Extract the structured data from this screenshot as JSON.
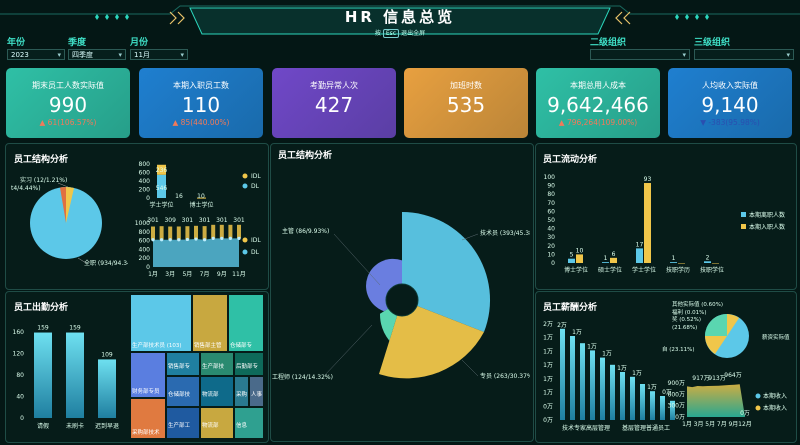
{
  "header": {
    "title": "HR 信息总览",
    "hint_pre": "按",
    "hint_key": "Esc",
    "hint_post": "退出全屏"
  },
  "filters": {
    "year": {
      "label": "年份",
      "value": "2023"
    },
    "quarter": {
      "label": "季度",
      "value": "四季度"
    },
    "month": {
      "label": "月份",
      "value": "11月"
    },
    "org2": {
      "label": "二级组织",
      "value": ""
    },
    "org3": {
      "label": "三级组织",
      "value": ""
    }
  },
  "kpis": [
    {
      "title": "期末员工人数实际值",
      "value": "990",
      "change": "▲ 61(106.57%)",
      "color": "#2fc0a6"
    },
    {
      "title": "本期入职员工数",
      "value": "110",
      "change": "▲ 85(440.00%)",
      "color": "#1f7fd0"
    },
    {
      "title": "考勤异常人次",
      "value": "427",
      "change": "",
      "color": "#7048c8"
    },
    {
      "title": "加班时数",
      "value": "535",
      "change": "",
      "color": "#e8a040"
    },
    {
      "title": "本期总用人成本",
      "value": "9,642,466",
      "change": "▲ 796,264(109.00%)",
      "color": "#2fc0a6"
    },
    {
      "title": "人均收入实际值",
      "value": "9,140",
      "change": "▼ -383(95.98%)",
      "color": "#1f7fd0"
    }
  ],
  "panels": {
    "structure_left": "员工结构分析",
    "structure_center": "员工结构分析",
    "flow": "员工流动分析",
    "attendance": "员工出勤分析",
    "salary": "员工薪酬分析"
  },
  "structure_pie": {
    "labels": [
      "实习 (12/1.21%)",
      "t4/4.44%)",
      "全职 (934/94.34%)"
    ]
  },
  "edu_bar": {
    "yticks": [
      "800",
      "600",
      "400",
      "200",
      "0"
    ],
    "categories": [
      "学士学位",
      "博士学位"
    ],
    "idl": [
      236,
      10
    ],
    "dl": [
      546,
      0
    ],
    "data_labels": [
      "236",
      "546",
      "16",
      "10"
    ],
    "legend": [
      "IDL",
      "DL"
    ]
  },
  "month_chart": {
    "yticks": [
      "1000",
      "800",
      "600",
      "400",
      "200",
      "0"
    ],
    "months": [
      "1月",
      "3月",
      "5月",
      "7月",
      "9月",
      "11月"
    ],
    "idl": [
      301,
      309,
      301,
      301,
      301,
      301,
      309,
      309,
      309,
      309,
      309
    ],
    "dl": [
      619,
      619,
      619,
      620,
      626,
      635,
      620,
      650,
      650,
      650,
      650
    ],
    "top_labels": [
      "301",
      "309",
      "301",
      "301",
      "301",
      "301"
    ],
    "legend": [
      "IDL",
      "DL"
    ]
  },
  "rose": {
    "labels": [
      "主管 (86/9.93%)",
      "技术员 (393/45.38%)",
      "专员 (263/30.37%)",
      "工程师 (124/14.32%)"
    ]
  },
  "flow_chart": {
    "yticks": [
      "100",
      "90",
      "80",
      "70",
      "60",
      "50",
      "40",
      "30",
      "20",
      "10",
      "0"
    ],
    "categories": [
      "博士学位",
      "硕士学位",
      "学士学位",
      "技职学历",
      "技职学位"
    ],
    "leave": [
      5,
      1,
      17,
      1,
      2
    ],
    "join": [
      10,
      6,
      93,
      0,
      0
    ],
    "legend": [
      "本期离职人数",
      "本期入职人数"
    ]
  },
  "attendance": {
    "yticks": [
      "160",
      "120",
      "80",
      "40",
      "0"
    ],
    "categories": [
      "请假",
      "未刷卡",
      "迟到早退"
    ],
    "values": [
      159,
      159,
      109
    ],
    "labels": [
      "159",
      "159",
      "109"
    ]
  },
  "treemap": [
    "生产部技术员 (103)",
    "销售部主管",
    "仓储部专",
    "财务部专员",
    "销售部专",
    "生产部技",
    "后勤部专",
    "采购部技术",
    "仓储部技",
    "物流部",
    "采购",
    "人事",
    "生产部工",
    "物流部",
    "信息"
  ],
  "salary": {
    "yticks": [
      "2万",
      "1万",
      "1万",
      "1万",
      "1万",
      "1万",
      "0万",
      "0万"
    ],
    "categories": [
      "技术专家高层管理",
      "基层管理普通员工"
    ],
    "bar_values": [
      1.9,
      1.75,
      1.6,
      1.45,
      1.3,
      1.15,
      1.0,
      0.9,
      0.75,
      0.6,
      0.5,
      0.4
    ],
    "bar_labels": [
      "2万",
      "1万",
      "1万",
      "1万",
      "1万",
      "1万",
      "1万",
      "0万"
    ],
    "pie_labels": [
      "其他实际值 (0.60%)",
      "福利 (0.01%)",
      "奖 (0.52%)",
      "(21.68%)",
      "自 (23.11%)",
      "薪资实际值"
    ],
    "area_yticks": [
      "900万",
      "600万",
      "300万",
      "0万"
    ],
    "area_months": [
      "1月",
      "3月",
      "5月",
      "7月",
      "9月",
      "12月"
    ],
    "area_top": [
      "917万",
      "913万",
      "964万"
    ],
    "area_end": "0万",
    "legend": [
      "本期收入",
      "本期收入"
    ]
  }
}
